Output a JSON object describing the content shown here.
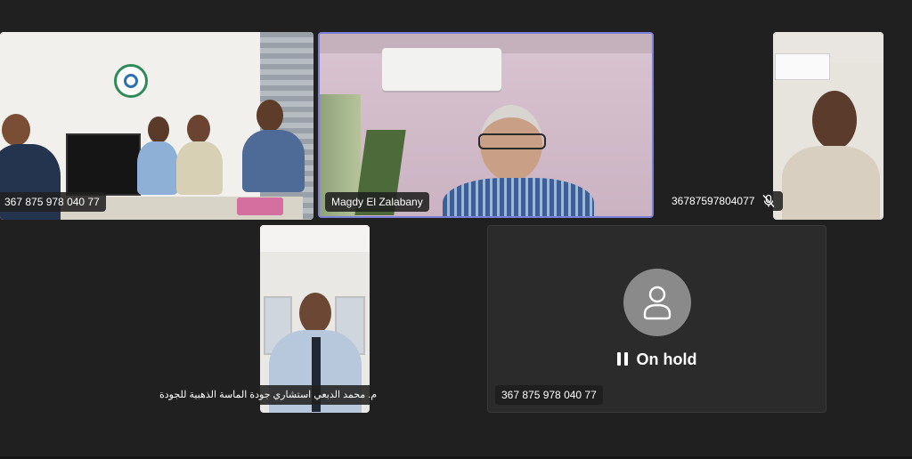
{
  "participants": [
    {
      "label": "367 875 978 040 77",
      "muted": false
    },
    {
      "label": "Magdy El Zalabany",
      "muted": false,
      "active_speaker": true
    },
    {
      "label": "36787597804077",
      "muted": true
    },
    {
      "label": "م. محمد الدبعي استشاري جودة الماسة الذهبية للجودة",
      "muted": false
    },
    {
      "label": "367 875 978 040 77",
      "status": "On hold",
      "muted": false
    }
  ],
  "colors": {
    "background": "#202020",
    "active_border": "#7b7fd8",
    "hold_tile": "#2b2b2b",
    "avatar_circle": "#8a8a8a"
  },
  "icons": {
    "mic_off": "mic-off-icon",
    "pause": "pause-icon",
    "avatar": "person-avatar-icon"
  }
}
